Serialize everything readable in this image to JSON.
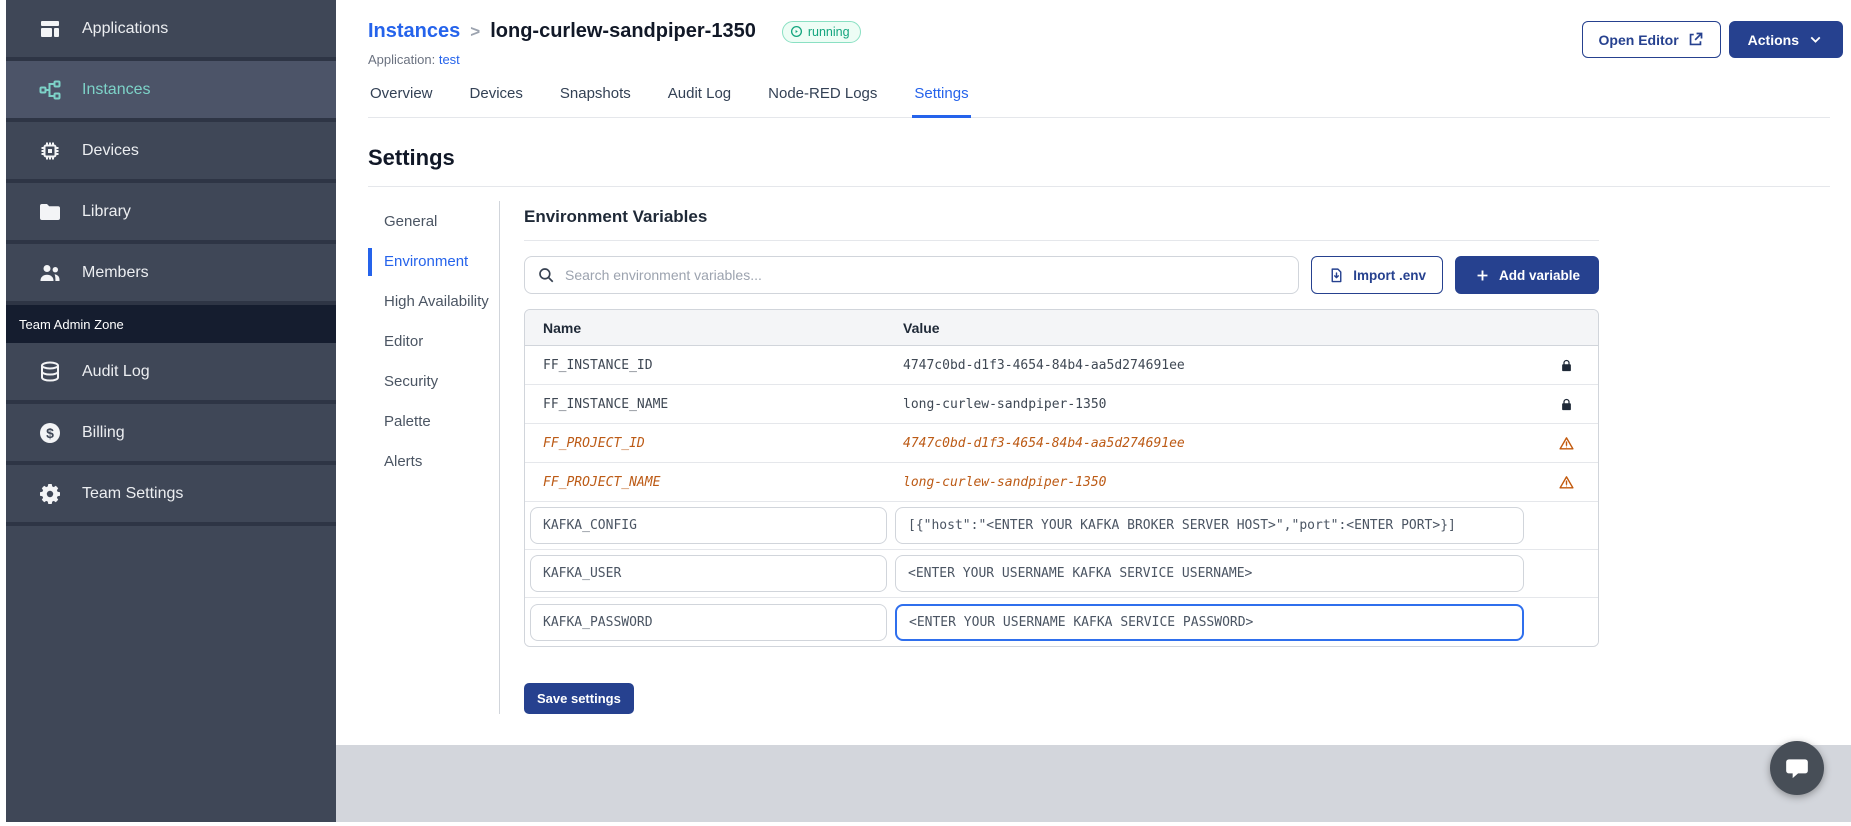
{
  "sidebar": {
    "items": [
      {
        "label": "Applications"
      },
      {
        "label": "Instances"
      },
      {
        "label": "Devices"
      },
      {
        "label": "Library"
      },
      {
        "label": "Members"
      }
    ],
    "section_label": "Team Admin Zone",
    "admin_items": [
      {
        "label": "Audit Log"
      },
      {
        "label": "Billing"
      },
      {
        "label": "Team Settings"
      }
    ]
  },
  "header": {
    "breadcrumb": {
      "parent": "Instances",
      "separator": ">",
      "current": "long-curlew-sandpiper-1350"
    },
    "status_label": "running",
    "application_label": "Application:",
    "application_value": "test",
    "open_editor_label": "Open Editor",
    "actions_label": "Actions"
  },
  "tabs": {
    "items": [
      {
        "label": "Overview"
      },
      {
        "label": "Devices"
      },
      {
        "label": "Snapshots"
      },
      {
        "label": "Audit Log"
      },
      {
        "label": "Node-RED Logs"
      },
      {
        "label": "Settings"
      }
    ],
    "active": "Settings"
  },
  "settings": {
    "title": "Settings",
    "nav": [
      {
        "label": "General"
      },
      {
        "label": "Environment"
      },
      {
        "label": "High Availability"
      },
      {
        "label": "Editor"
      },
      {
        "label": "Security"
      },
      {
        "label": "Palette"
      },
      {
        "label": "Alerts"
      }
    ],
    "active": "Environment"
  },
  "env": {
    "title": "Environment Variables",
    "search_placeholder": "Search environment variables...",
    "import_label": "Import .env",
    "add_label": "Add variable",
    "columns": {
      "name": "Name",
      "value": "Value"
    },
    "rows": [
      {
        "name": "FF_INSTANCE_ID",
        "value": "4747c0bd-d1f3-4654-84b4-aa5d274691ee",
        "type": "locked"
      },
      {
        "name": "FF_INSTANCE_NAME",
        "value": "long-curlew-sandpiper-1350",
        "type": "locked"
      },
      {
        "name": "FF_PROJECT_ID",
        "value": "4747c0bd-d1f3-4654-84b4-aa5d274691ee",
        "type": "deprecated"
      },
      {
        "name": "FF_PROJECT_NAME",
        "value": "long-curlew-sandpiper-1350",
        "type": "deprecated"
      },
      {
        "name": "KAFKA_CONFIG",
        "value": "[{\"host\":\"<ENTER YOUR KAFKA BROKER SERVER HOST>\",\"port\":<ENTER PORT>}]",
        "type": "editable"
      },
      {
        "name": "KAFKA_USER",
        "value": "<ENTER YOUR USERNAME KAFKA SERVICE USERNAME>",
        "type": "editable"
      },
      {
        "name": "KAFKA_PASSWORD",
        "value": "<ENTER YOUR USERNAME KAFKA SERVICE PASSWORD>",
        "type": "editable",
        "focused": true
      }
    ],
    "save_label": "Save settings"
  },
  "colors": {
    "sidebar_bg": "#3f4757",
    "sidebar_active_bg": "#4c5468",
    "sidebar_active_text": "#7dd3c8",
    "admin_zone_bg": "#151d2f",
    "link_blue": "#2563eb",
    "button_blue": "#26418f",
    "status_green": "#13a57e",
    "deprecated_orange": "#bc5a15",
    "footer_gray": "#d3d6dc"
  }
}
